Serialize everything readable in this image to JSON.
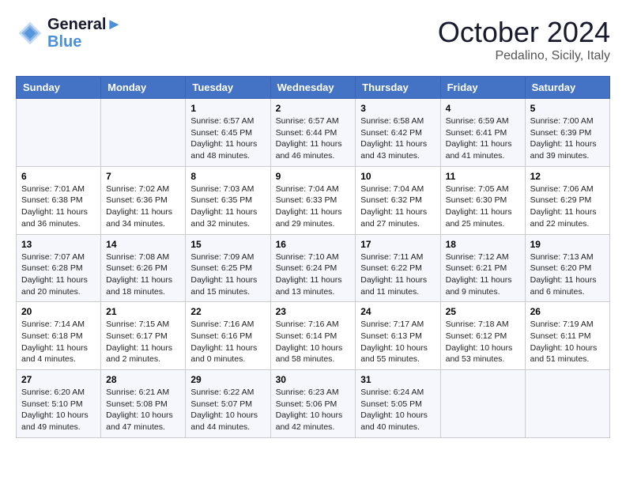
{
  "header": {
    "logo_line1": "General",
    "logo_line2": "Blue",
    "month": "October 2024",
    "location": "Pedalino, Sicily, Italy"
  },
  "columns": [
    "Sunday",
    "Monday",
    "Tuesday",
    "Wednesday",
    "Thursday",
    "Friday",
    "Saturday"
  ],
  "weeks": [
    [
      {
        "day": "",
        "info": ""
      },
      {
        "day": "",
        "info": ""
      },
      {
        "day": "1",
        "info": "Sunrise: 6:57 AM\nSunset: 6:45 PM\nDaylight: 11 hours and 48 minutes."
      },
      {
        "day": "2",
        "info": "Sunrise: 6:57 AM\nSunset: 6:44 PM\nDaylight: 11 hours and 46 minutes."
      },
      {
        "day": "3",
        "info": "Sunrise: 6:58 AM\nSunset: 6:42 PM\nDaylight: 11 hours and 43 minutes."
      },
      {
        "day": "4",
        "info": "Sunrise: 6:59 AM\nSunset: 6:41 PM\nDaylight: 11 hours and 41 minutes."
      },
      {
        "day": "5",
        "info": "Sunrise: 7:00 AM\nSunset: 6:39 PM\nDaylight: 11 hours and 39 minutes."
      }
    ],
    [
      {
        "day": "6",
        "info": "Sunrise: 7:01 AM\nSunset: 6:38 PM\nDaylight: 11 hours and 36 minutes."
      },
      {
        "day": "7",
        "info": "Sunrise: 7:02 AM\nSunset: 6:36 PM\nDaylight: 11 hours and 34 minutes."
      },
      {
        "day": "8",
        "info": "Sunrise: 7:03 AM\nSunset: 6:35 PM\nDaylight: 11 hours and 32 minutes."
      },
      {
        "day": "9",
        "info": "Sunrise: 7:04 AM\nSunset: 6:33 PM\nDaylight: 11 hours and 29 minutes."
      },
      {
        "day": "10",
        "info": "Sunrise: 7:04 AM\nSunset: 6:32 PM\nDaylight: 11 hours and 27 minutes."
      },
      {
        "day": "11",
        "info": "Sunrise: 7:05 AM\nSunset: 6:30 PM\nDaylight: 11 hours and 25 minutes."
      },
      {
        "day": "12",
        "info": "Sunrise: 7:06 AM\nSunset: 6:29 PM\nDaylight: 11 hours and 22 minutes."
      }
    ],
    [
      {
        "day": "13",
        "info": "Sunrise: 7:07 AM\nSunset: 6:28 PM\nDaylight: 11 hours and 20 minutes."
      },
      {
        "day": "14",
        "info": "Sunrise: 7:08 AM\nSunset: 6:26 PM\nDaylight: 11 hours and 18 minutes."
      },
      {
        "day": "15",
        "info": "Sunrise: 7:09 AM\nSunset: 6:25 PM\nDaylight: 11 hours and 15 minutes."
      },
      {
        "day": "16",
        "info": "Sunrise: 7:10 AM\nSunset: 6:24 PM\nDaylight: 11 hours and 13 minutes."
      },
      {
        "day": "17",
        "info": "Sunrise: 7:11 AM\nSunset: 6:22 PM\nDaylight: 11 hours and 11 minutes."
      },
      {
        "day": "18",
        "info": "Sunrise: 7:12 AM\nSunset: 6:21 PM\nDaylight: 11 hours and 9 minutes."
      },
      {
        "day": "19",
        "info": "Sunrise: 7:13 AM\nSunset: 6:20 PM\nDaylight: 11 hours and 6 minutes."
      }
    ],
    [
      {
        "day": "20",
        "info": "Sunrise: 7:14 AM\nSunset: 6:18 PM\nDaylight: 11 hours and 4 minutes."
      },
      {
        "day": "21",
        "info": "Sunrise: 7:15 AM\nSunset: 6:17 PM\nDaylight: 11 hours and 2 minutes."
      },
      {
        "day": "22",
        "info": "Sunrise: 7:16 AM\nSunset: 6:16 PM\nDaylight: 11 hours and 0 minutes."
      },
      {
        "day": "23",
        "info": "Sunrise: 7:16 AM\nSunset: 6:14 PM\nDaylight: 10 hours and 58 minutes."
      },
      {
        "day": "24",
        "info": "Sunrise: 7:17 AM\nSunset: 6:13 PM\nDaylight: 10 hours and 55 minutes."
      },
      {
        "day": "25",
        "info": "Sunrise: 7:18 AM\nSunset: 6:12 PM\nDaylight: 10 hours and 53 minutes."
      },
      {
        "day": "26",
        "info": "Sunrise: 7:19 AM\nSunset: 6:11 PM\nDaylight: 10 hours and 51 minutes."
      }
    ],
    [
      {
        "day": "27",
        "info": "Sunrise: 6:20 AM\nSunset: 5:10 PM\nDaylight: 10 hours and 49 minutes."
      },
      {
        "day": "28",
        "info": "Sunrise: 6:21 AM\nSunset: 5:08 PM\nDaylight: 10 hours and 47 minutes."
      },
      {
        "day": "29",
        "info": "Sunrise: 6:22 AM\nSunset: 5:07 PM\nDaylight: 10 hours and 44 minutes."
      },
      {
        "day": "30",
        "info": "Sunrise: 6:23 AM\nSunset: 5:06 PM\nDaylight: 10 hours and 42 minutes."
      },
      {
        "day": "31",
        "info": "Sunrise: 6:24 AM\nSunset: 5:05 PM\nDaylight: 10 hours and 40 minutes."
      },
      {
        "day": "",
        "info": ""
      },
      {
        "day": "",
        "info": ""
      }
    ]
  ]
}
